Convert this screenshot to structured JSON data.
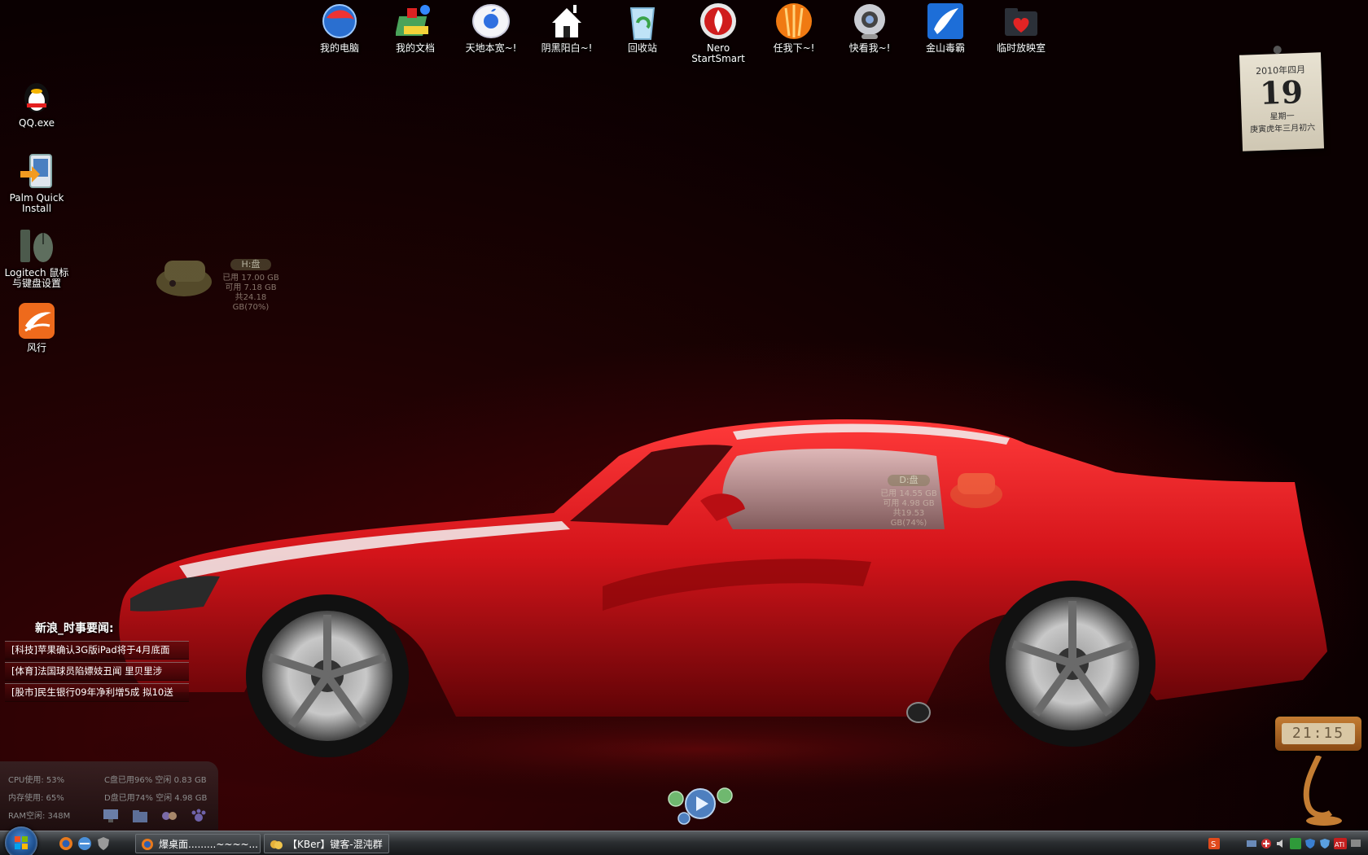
{
  "desktop": {
    "top_icons": [
      {
        "label": "我的电脑",
        "icon": "computer-globe-icon"
      },
      {
        "label": "我的文档",
        "icon": "documents-icon"
      },
      {
        "label": "天地本宽~!",
        "icon": "apple-orb-icon"
      },
      {
        "label": "阴黑阳白~!",
        "icon": "house-icon"
      },
      {
        "label": "回收站",
        "icon": "recycle-bin-icon"
      },
      {
        "label": "Nero StartSmart",
        "icon": "nero-flame-icon"
      },
      {
        "label": "任我下~!",
        "icon": "bittorrent-icon"
      },
      {
        "label": "快看我~!",
        "icon": "webcam-icon"
      },
      {
        "label": "金山毒霸",
        "icon": "kingsoft-antivirus-icon"
      },
      {
        "label": "临时放映室",
        "icon": "folder-heart-icon"
      }
    ],
    "left_icons": [
      {
        "label": "QQ.exe",
        "icon": "qq-penguin-icon"
      },
      {
        "label": "Palm Quick Install",
        "icon": "palm-install-icon"
      },
      {
        "label": "Logitech 鼠标与键盘设置",
        "icon": "logitech-mouse-keyboard-icon"
      },
      {
        "label": "风行",
        "icon": "funshion-icon"
      }
    ]
  },
  "calendar": {
    "year_month": "2010年四月",
    "day": "19",
    "weekday": "星期一",
    "lunar": "庚寅虎年三月初六"
  },
  "disk_h": {
    "label": "H:盘",
    "used": "已用 17.00 GB",
    "free": "可用 7.18 GB",
    "total": "共24.18 GB(70%)"
  },
  "disk_d": {
    "label": "D:盘",
    "used": "已用 14.55 GB",
    "free": "可用 4.98 GB",
    "total": "共19.53 GB(74%)"
  },
  "news": {
    "title": "新浪_时事要闻:",
    "items": [
      "[科技]苹果确认3G版iPad将于4月底面",
      "[体育]法国球员陷嫖妓丑闻 里贝里涉",
      "[股市]民生银行09年净利增5成 拟10送"
    ]
  },
  "sysmon": {
    "cpu": "CPU使用: 53%",
    "mem": "内存使用: 65%",
    "ram": "RAM空闲: 348M",
    "c_drive": "C盘已用96% 空闲 0.83 GB",
    "d_drive": "D盘已用74% 空闲 4.98 GB"
  },
  "clock": {
    "time": "21:15"
  },
  "taskbar": {
    "buttons": [
      {
        "label": "爆桌面.........~~~~..."
      },
      {
        "label": "【KBer】键客-混沌群"
      }
    ]
  },
  "colors": {
    "car_red": "#d4141a",
    "background_dark": "#1d0203",
    "taskbar": "#2b2e31"
  }
}
